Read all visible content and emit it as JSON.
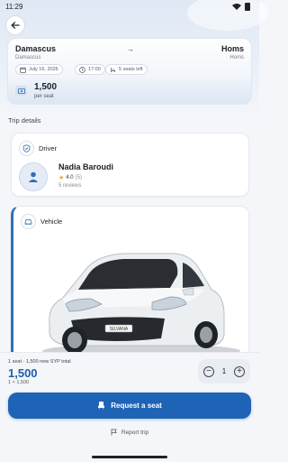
{
  "status_bar": {
    "time": "11:29"
  },
  "route": {
    "from_city": "Damascus",
    "from_sub": "Damascus",
    "to_city": "Homs",
    "to_sub": "Homs",
    "arrow": "→",
    "date": "July 16, 2026",
    "time": "17:00",
    "seats_left": "5 seats left",
    "price": "1,500",
    "price_unit": "per seat"
  },
  "trip_details": {
    "section_title": "Trip details",
    "driver": {
      "heading": "Driver",
      "name": "Nadia Baroudi",
      "rating": "4.0",
      "rating_count": "(5)",
      "reviews": "5 reviews"
    },
    "vehicle": {
      "heading": "Vehicle",
      "car_color": "#f1f3f5",
      "plate": "SILVANA"
    }
  },
  "booking": {
    "summary": "1 seat · 1,500 new SYP total",
    "total": "1,500",
    "calc": "1 × 1,500",
    "quantity": "1",
    "minus": "−",
    "plus": "+",
    "request_label": "Request a seat",
    "report_label": "Report trip"
  },
  "colors": {
    "accent": "#1e63b5",
    "price_text": "#1d5fae",
    "star": "#e9a825"
  },
  "icons": [
    "back-arrow-icon",
    "calendar-icon",
    "clock-icon",
    "seat-icon",
    "wallet-icon",
    "shield-icon",
    "person-icon",
    "star-icon",
    "car-icon",
    "flag-icon"
  ]
}
